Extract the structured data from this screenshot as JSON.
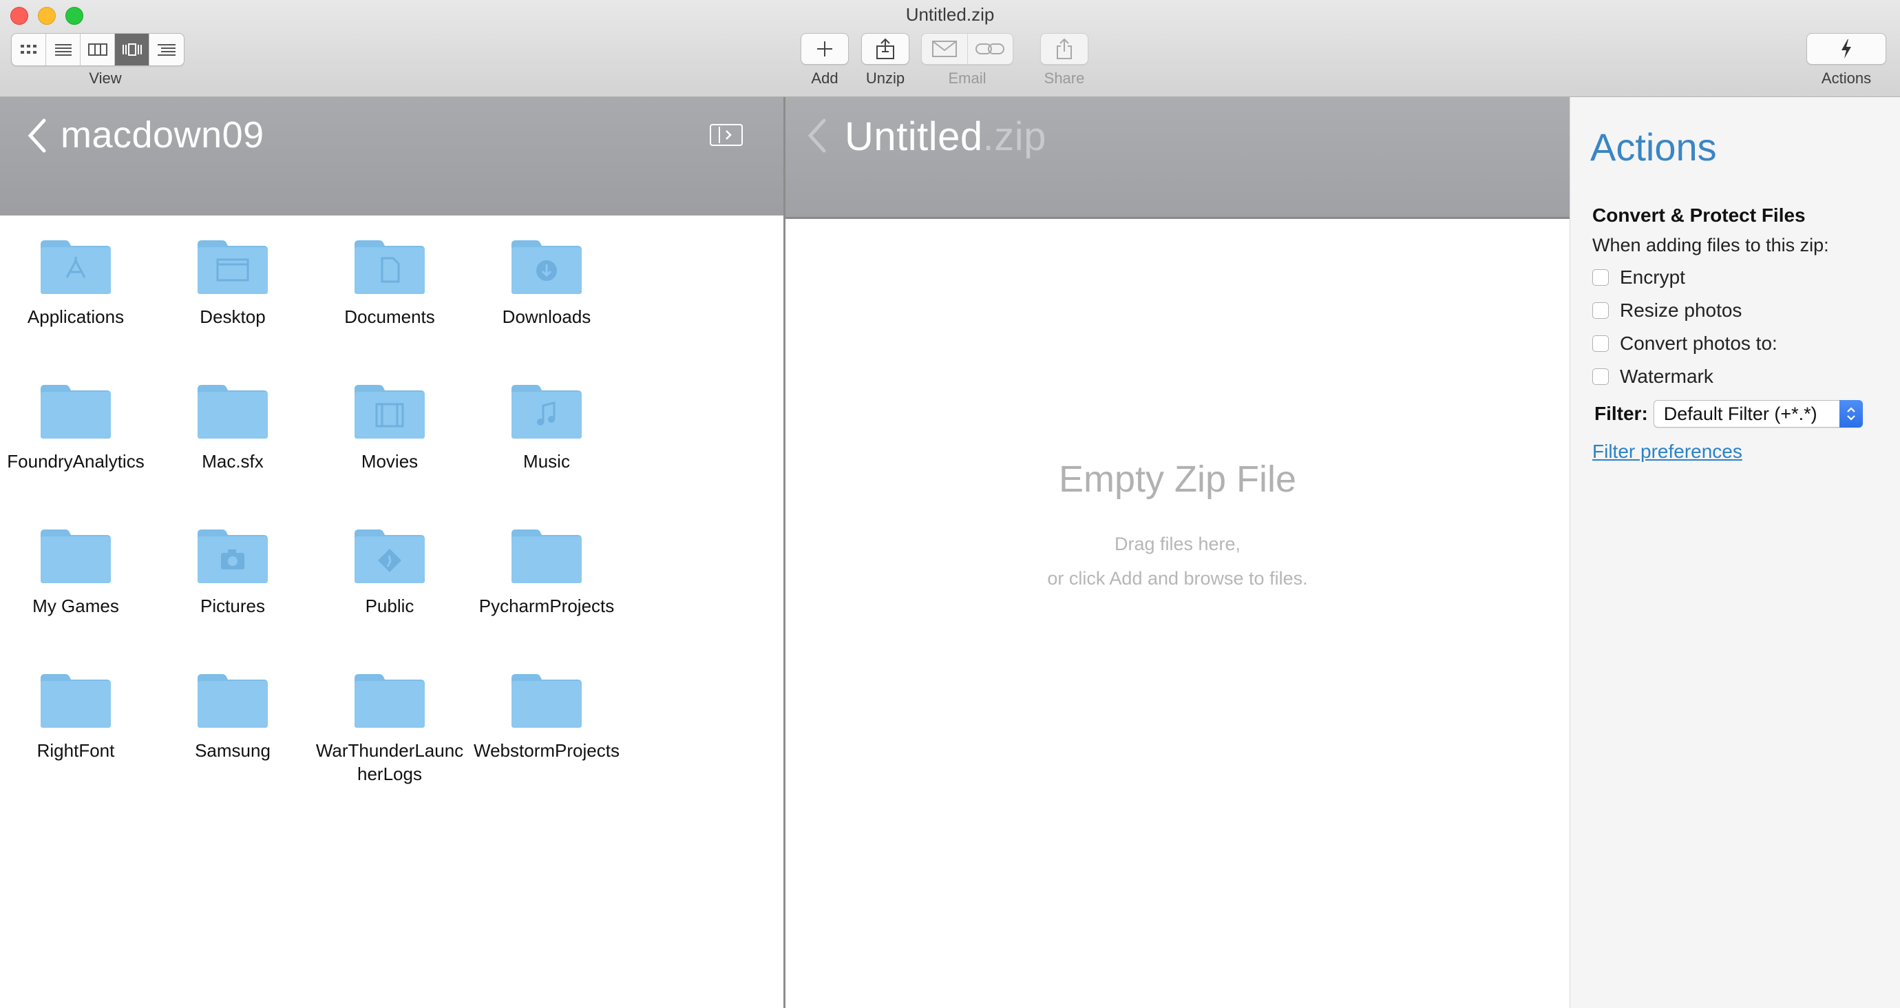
{
  "window": {
    "title": "Untitled.zip"
  },
  "toolbar": {
    "view_label": "View",
    "view_modes": [
      "icon-view",
      "list-view",
      "column-view",
      "cover-flow-view",
      "outline-view"
    ],
    "active_view_mode": "cover-flow-view",
    "add_label": "Add",
    "unzip_label": "Unzip",
    "email_label": "Email",
    "share_label": "Share",
    "actions_label": "Actions"
  },
  "browser": {
    "folder_title": "macdown09",
    "items": [
      {
        "label": "Applications",
        "icon": "applications-folder-icon"
      },
      {
        "label": "Desktop",
        "icon": "desktop-folder-icon"
      },
      {
        "label": "Documents",
        "icon": "documents-folder-icon"
      },
      {
        "label": "Downloads",
        "icon": "downloads-folder-icon"
      },
      {
        "label": "FoundryAnalytics",
        "icon": "folder-icon"
      },
      {
        "label": "Mac.sfx",
        "icon": "folder-icon"
      },
      {
        "label": "Movies",
        "icon": "movies-folder-icon"
      },
      {
        "label": "Music",
        "icon": "music-folder-icon"
      },
      {
        "label": "My Games",
        "icon": "folder-icon"
      },
      {
        "label": "Pictures",
        "icon": "pictures-folder-icon"
      },
      {
        "label": "Public",
        "icon": "public-folder-icon"
      },
      {
        "label": "PycharmProjects",
        "icon": "folder-icon"
      },
      {
        "label": "RightFont",
        "icon": "folder-icon"
      },
      {
        "label": "Samsung",
        "icon": "folder-icon"
      },
      {
        "label": "WarThunderLauncherLogs",
        "icon": "folder-icon"
      },
      {
        "label": "WebstormProjects",
        "icon": "folder-icon"
      }
    ]
  },
  "zip": {
    "title_name": "Untitled",
    "title_ext": ".zip",
    "empty_title": "Empty Zip File",
    "empty_line1": "Drag files here,",
    "empty_line2": "or click Add and browse to files."
  },
  "actions": {
    "title": "Actions",
    "section_title": "Convert & Protect Files",
    "section_subtitle": "When adding files to this zip:",
    "options": [
      {
        "label": "Encrypt",
        "checked": false
      },
      {
        "label": "Resize photos",
        "checked": false
      },
      {
        "label": "Convert photos to:",
        "checked": false
      },
      {
        "label": "Watermark",
        "checked": false
      }
    ],
    "filter_label": "Filter:",
    "filter_value": "Default Filter (+*.*)",
    "filter_link": "Filter preferences"
  },
  "colors": {
    "folder_blue": "#8cc8f0",
    "accent_blue": "#3a86c4",
    "link_blue": "#2a82c8",
    "header_gray": "#a3a4a8"
  }
}
